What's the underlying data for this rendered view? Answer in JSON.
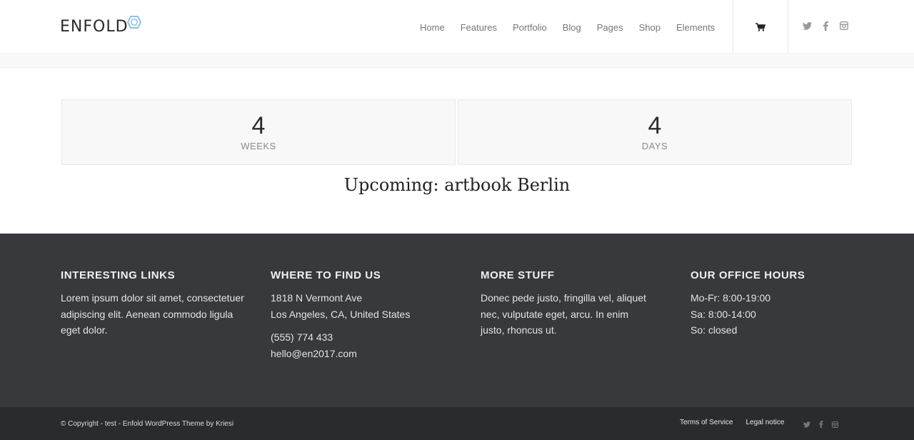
{
  "header": {
    "logo_text": "ENFOLD",
    "nav": [
      "Home",
      "Features",
      "Portfolio",
      "Blog",
      "Pages",
      "Shop",
      "Elements"
    ],
    "icons": [
      "cart-icon",
      "twitter-icon",
      "facebook-icon",
      "instagram-icon"
    ]
  },
  "countdown": {
    "weeks_value": "4",
    "weeks_label": "WEEKS",
    "days_value": "4",
    "days_label": "DAYS"
  },
  "upcoming": "Upcoming: artbook Berlin",
  "footer": {
    "col1": {
      "title": "INTERESTING LINKS",
      "text": "Lorem ipsum dolor sit amet, consectetuer adipiscing elit. Aenean commodo ligula eget dolor."
    },
    "col2": {
      "title": "WHERE TO FIND US",
      "address_line1": "1818 N Vermont Ave",
      "address_line2": "Los Angeles, CA, United States",
      "phone": "(555) 774 433",
      "email": "hello@en2017.com"
    },
    "col3": {
      "title": "MORE STUFF",
      "text": "Donec pede justo, fringilla vel, aliquet nec, vulputate eget, arcu. In enim justo, rhoncus ut."
    },
    "col4": {
      "title": "OUR OFFICE HOURS",
      "line1": "Mo-Fr: 8:00-19:00",
      "line2": "Sa: 8:00-14:00",
      "line3": "So: closed"
    }
  },
  "socket": {
    "copyright": "© Copyright - test - Enfold WordPress Theme by Kriesi",
    "links": [
      "Terms of Service",
      "Legal notice"
    ]
  },
  "colors": {
    "logo_accent": "#8fc1e3",
    "footer_bg": "#37393d",
    "socket_bg": "#2a2b2e"
  }
}
